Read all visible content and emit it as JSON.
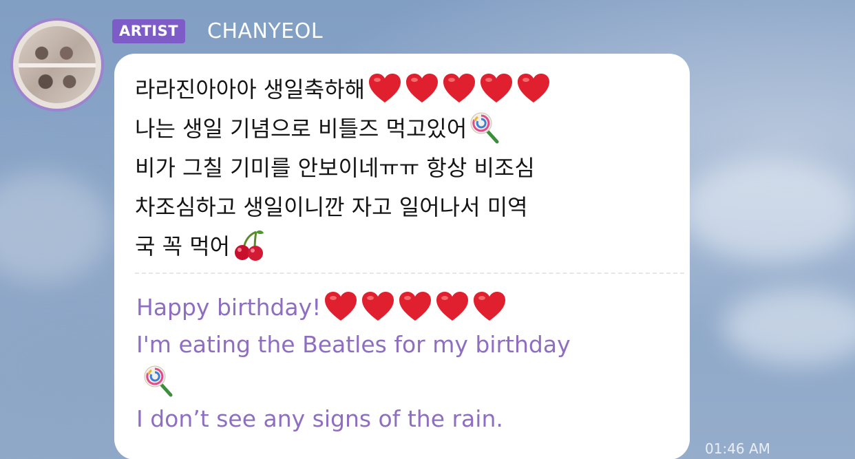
{
  "sender": {
    "badge": "ARTIST",
    "name": "CHANYEOL"
  },
  "message": {
    "korean_lines": [
      "라라진아아아 생일축하해",
      "나는 생일 기념으로 비틀즈 먹고있어",
      "비가 그칠 기미를 안보이네ㅠㅠ 항상 비조심",
      "차조심하고 생일이니깐 자고 일어나서 미역",
      "국 꼭 먹어"
    ],
    "english_lines": [
      "Happy birthday!",
      "I'm eating the Beatles for my birthday",
      "",
      "I don’t see any signs of the rain."
    ],
    "timestamp": "01:46 AM"
  },
  "icons": {
    "heart": "red-heart-icon",
    "lollipop": "lollipop-icon",
    "cherries": "cherries-icon"
  },
  "colors": {
    "badge_bg": "#7e5cc7",
    "translation_text": "#8e6ec0",
    "avatar_ring": "#9e83cf",
    "heart": "#e0202e"
  }
}
